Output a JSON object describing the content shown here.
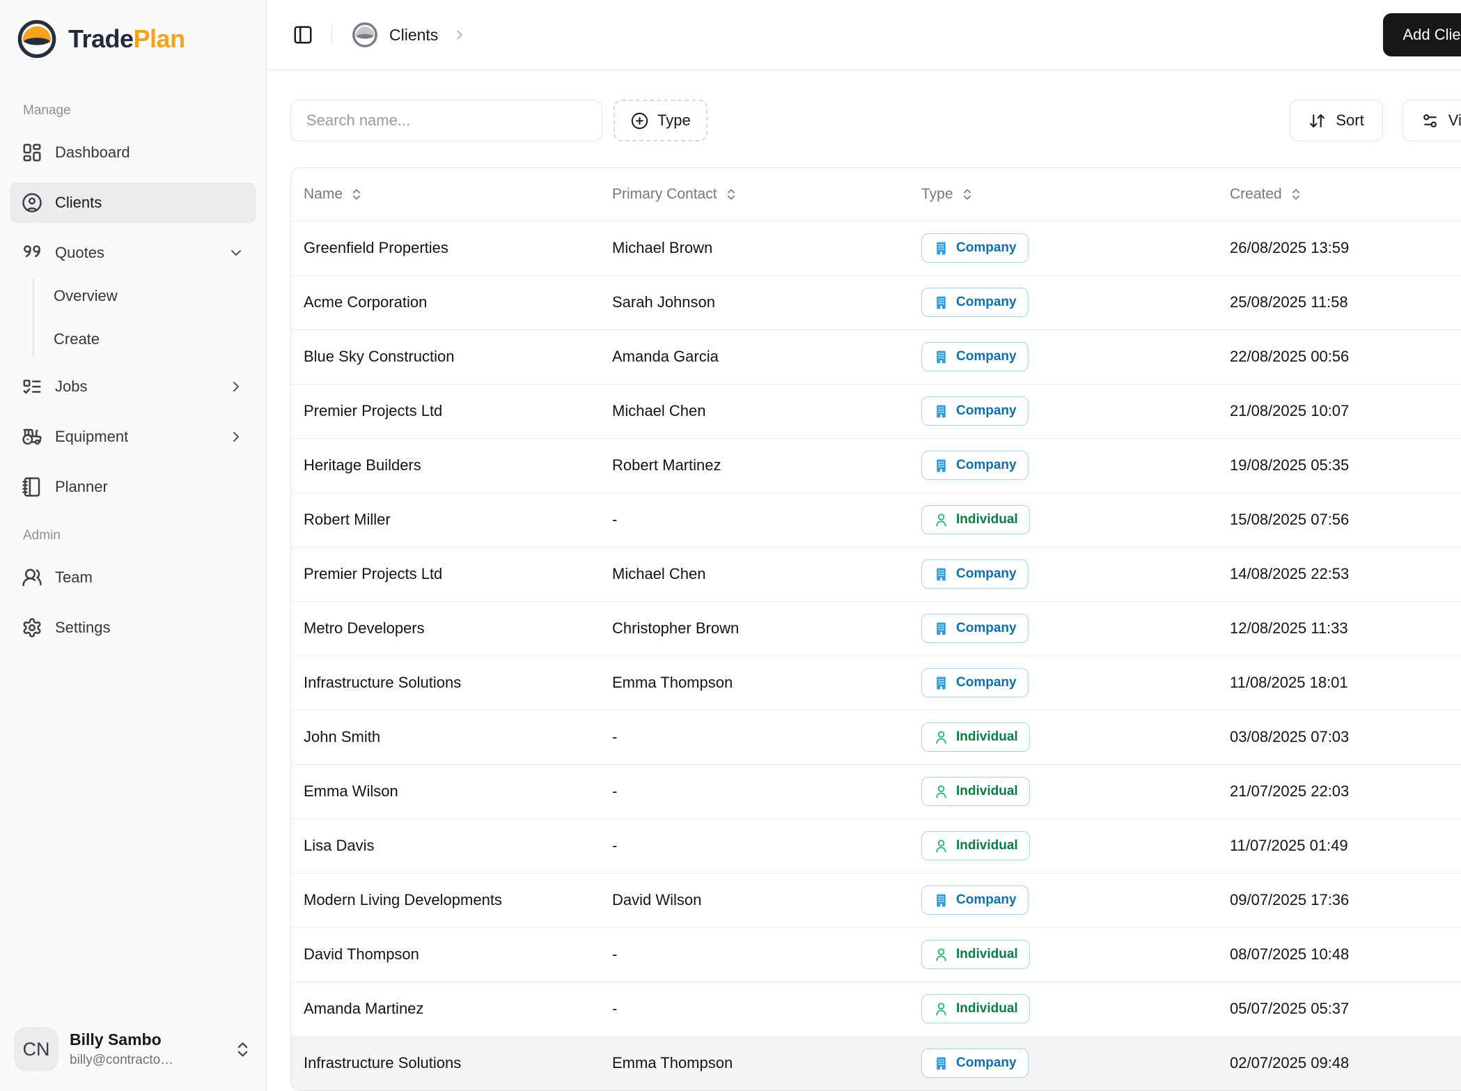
{
  "brand": {
    "name_part1": "Trade",
    "name_part2": "Plan",
    "logo_icon": "hardhat-icon"
  },
  "colors": {
    "accent_orange": "#F6A21D",
    "brand_navy": "#232B3A",
    "add_button_bg": "#17171A",
    "company_text": "#0F6FA9",
    "company_icon": "#2B9EE1",
    "company_border": "#A6D6F1",
    "individual_text": "#0C7C45",
    "individual_icon": "#2DBB74",
    "individual_border": "#A6E2C4",
    "sidebar_bg": "#FAFAFA"
  },
  "sidebar": {
    "sections": [
      {
        "label": "Manage",
        "items": [
          {
            "label": "Dashboard",
            "icon": "dashboard-icon"
          },
          {
            "label": "Clients",
            "icon": "clients-icon",
            "active": true
          },
          {
            "label": "Quotes",
            "icon": "quotes-icon",
            "expand": "down",
            "children": [
              "Overview",
              "Create"
            ]
          },
          {
            "label": "Jobs",
            "icon": "jobs-icon",
            "expand": "right"
          },
          {
            "label": "Equipment",
            "icon": "equipment-icon",
            "expand": "right"
          },
          {
            "label": "Planner",
            "icon": "planner-icon"
          }
        ]
      },
      {
        "label": "Admin",
        "items": [
          {
            "label": "Team",
            "icon": "team-icon"
          },
          {
            "label": "Settings",
            "icon": "settings-icon"
          }
        ]
      }
    ],
    "user": {
      "avatar_initials": "CN",
      "name": "Billy Sambo",
      "email": "billy@contracto…"
    }
  },
  "header": {
    "breadcrumb_page": "Clients",
    "add_button_label": "Add Client"
  },
  "toolbar": {
    "search_placeholder": "Search name...",
    "type_button_label": "Type",
    "sort_button_label": "Sort",
    "view_button_label": "View"
  },
  "badges": {
    "Company": {
      "label": "Company",
      "icon": "building-icon",
      "class": "company"
    },
    "Individual": {
      "label": "Individual",
      "icon": "person-icon",
      "class": "individual"
    }
  },
  "table": {
    "columns": [
      {
        "label": "Name",
        "sortable": true
      },
      {
        "label": "Primary Contact",
        "sortable": true
      },
      {
        "label": "Type",
        "sortable": true
      },
      {
        "label": "Created",
        "sortable": true
      }
    ],
    "rows": [
      {
        "name": "Greenfield Properties",
        "contact": "Michael Brown",
        "type": "Company",
        "created": "26/08/2025 13:59"
      },
      {
        "name": "Acme Corporation",
        "contact": "Sarah Johnson",
        "type": "Company",
        "created": "25/08/2025 11:58"
      },
      {
        "name": "Blue Sky Construction",
        "contact": "Amanda Garcia",
        "type": "Company",
        "created": "22/08/2025 00:56"
      },
      {
        "name": "Premier Projects Ltd",
        "contact": "Michael Chen",
        "type": "Company",
        "created": "21/08/2025 10:07"
      },
      {
        "name": "Heritage Builders",
        "contact": "Robert Martinez",
        "type": "Company",
        "created": "19/08/2025 05:35"
      },
      {
        "name": "Robert Miller",
        "contact": "-",
        "type": "Individual",
        "created": "15/08/2025 07:56"
      },
      {
        "name": "Premier Projects Ltd",
        "contact": "Michael Chen",
        "type": "Company",
        "created": "14/08/2025 22:53"
      },
      {
        "name": "Metro Developers",
        "contact": "Christopher Brown",
        "type": "Company",
        "created": "12/08/2025 11:33"
      },
      {
        "name": "Infrastructure Solutions",
        "contact": "Emma Thompson",
        "type": "Company",
        "created": "11/08/2025 18:01"
      },
      {
        "name": "John Smith",
        "contact": "-",
        "type": "Individual",
        "created": "03/08/2025 07:03"
      },
      {
        "name": "Emma Wilson",
        "contact": "-",
        "type": "Individual",
        "created": "21/07/2025 22:03"
      },
      {
        "name": "Lisa Davis",
        "contact": "-",
        "type": "Individual",
        "created": "11/07/2025 01:49"
      },
      {
        "name": "Modern Living Developments",
        "contact": "David Wilson",
        "type": "Company",
        "created": "09/07/2025 17:36"
      },
      {
        "name": "David Thompson",
        "contact": "-",
        "type": "Individual",
        "created": "08/07/2025 10:48"
      },
      {
        "name": "Amanda Martinez",
        "contact": "-",
        "type": "Individual",
        "created": "05/07/2025 05:37"
      },
      {
        "name": "Infrastructure Solutions",
        "contact": "Emma Thompson",
        "type": "Company",
        "created": "02/07/2025 09:48",
        "hovered": true
      }
    ]
  }
}
